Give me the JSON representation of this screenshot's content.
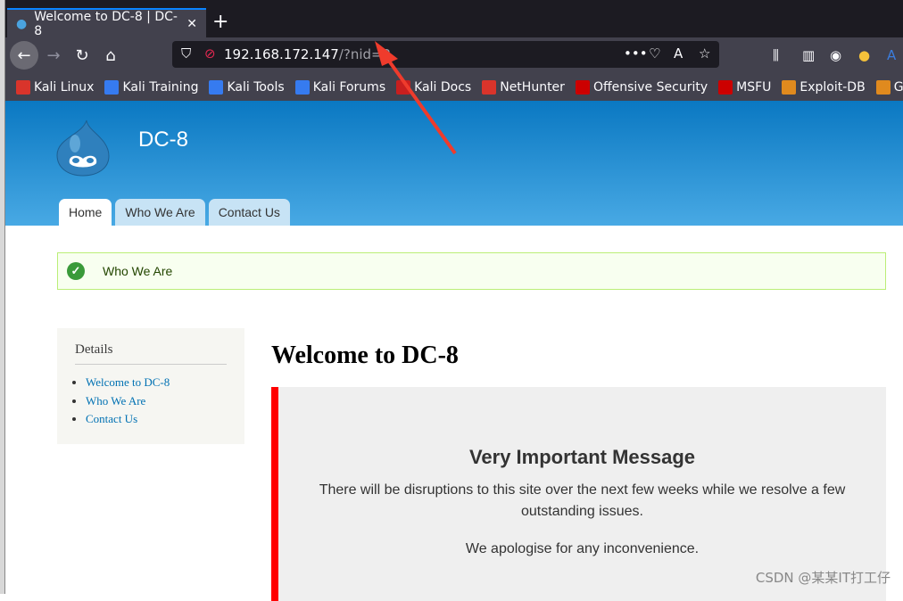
{
  "browser": {
    "tab_title": "Welcome to DC-8 | DC-8",
    "url_host": "192.168.172.147",
    "url_path": "/?nid=2",
    "bookmarks": [
      {
        "label": "Kali Linux",
        "color": "#d9342b"
      },
      {
        "label": "Kali Training",
        "color": "#367bf0"
      },
      {
        "label": "Kali Tools",
        "color": "#367bf0"
      },
      {
        "label": "Kali Forums",
        "color": "#367bf0"
      },
      {
        "label": "Kali Docs",
        "color": "#c81f1f"
      },
      {
        "label": "NetHunter",
        "color": "#d9342b"
      },
      {
        "label": "Offensive Security",
        "color": "#c00"
      },
      {
        "label": "MSFU",
        "color": "#c00"
      },
      {
        "label": "Exploit-DB",
        "color": "#e08a1e"
      },
      {
        "label": "GHDB",
        "color": "#e08a1e"
      }
    ]
  },
  "site": {
    "name": "DC-8",
    "tabs": [
      "Home",
      "Who We Are",
      "Contact Us"
    ],
    "status_message": "Who We Are",
    "sidebar": {
      "title": "Details",
      "links": [
        "Welcome to DC-8",
        "Who We Are",
        "Contact Us"
      ]
    },
    "page_title": "Welcome to DC-8",
    "notice": {
      "heading": "Very Important Message",
      "p1": "There will be disruptions to this site over the next few weeks while we resolve a few outstanding issues.",
      "p2": "We apologise for any inconvenience."
    }
  },
  "watermark": "CSDN @某某IT打工仔",
  "colors": {
    "header": "#0a78c2",
    "accent_border": "#ff0000",
    "link": "#0071b3"
  }
}
